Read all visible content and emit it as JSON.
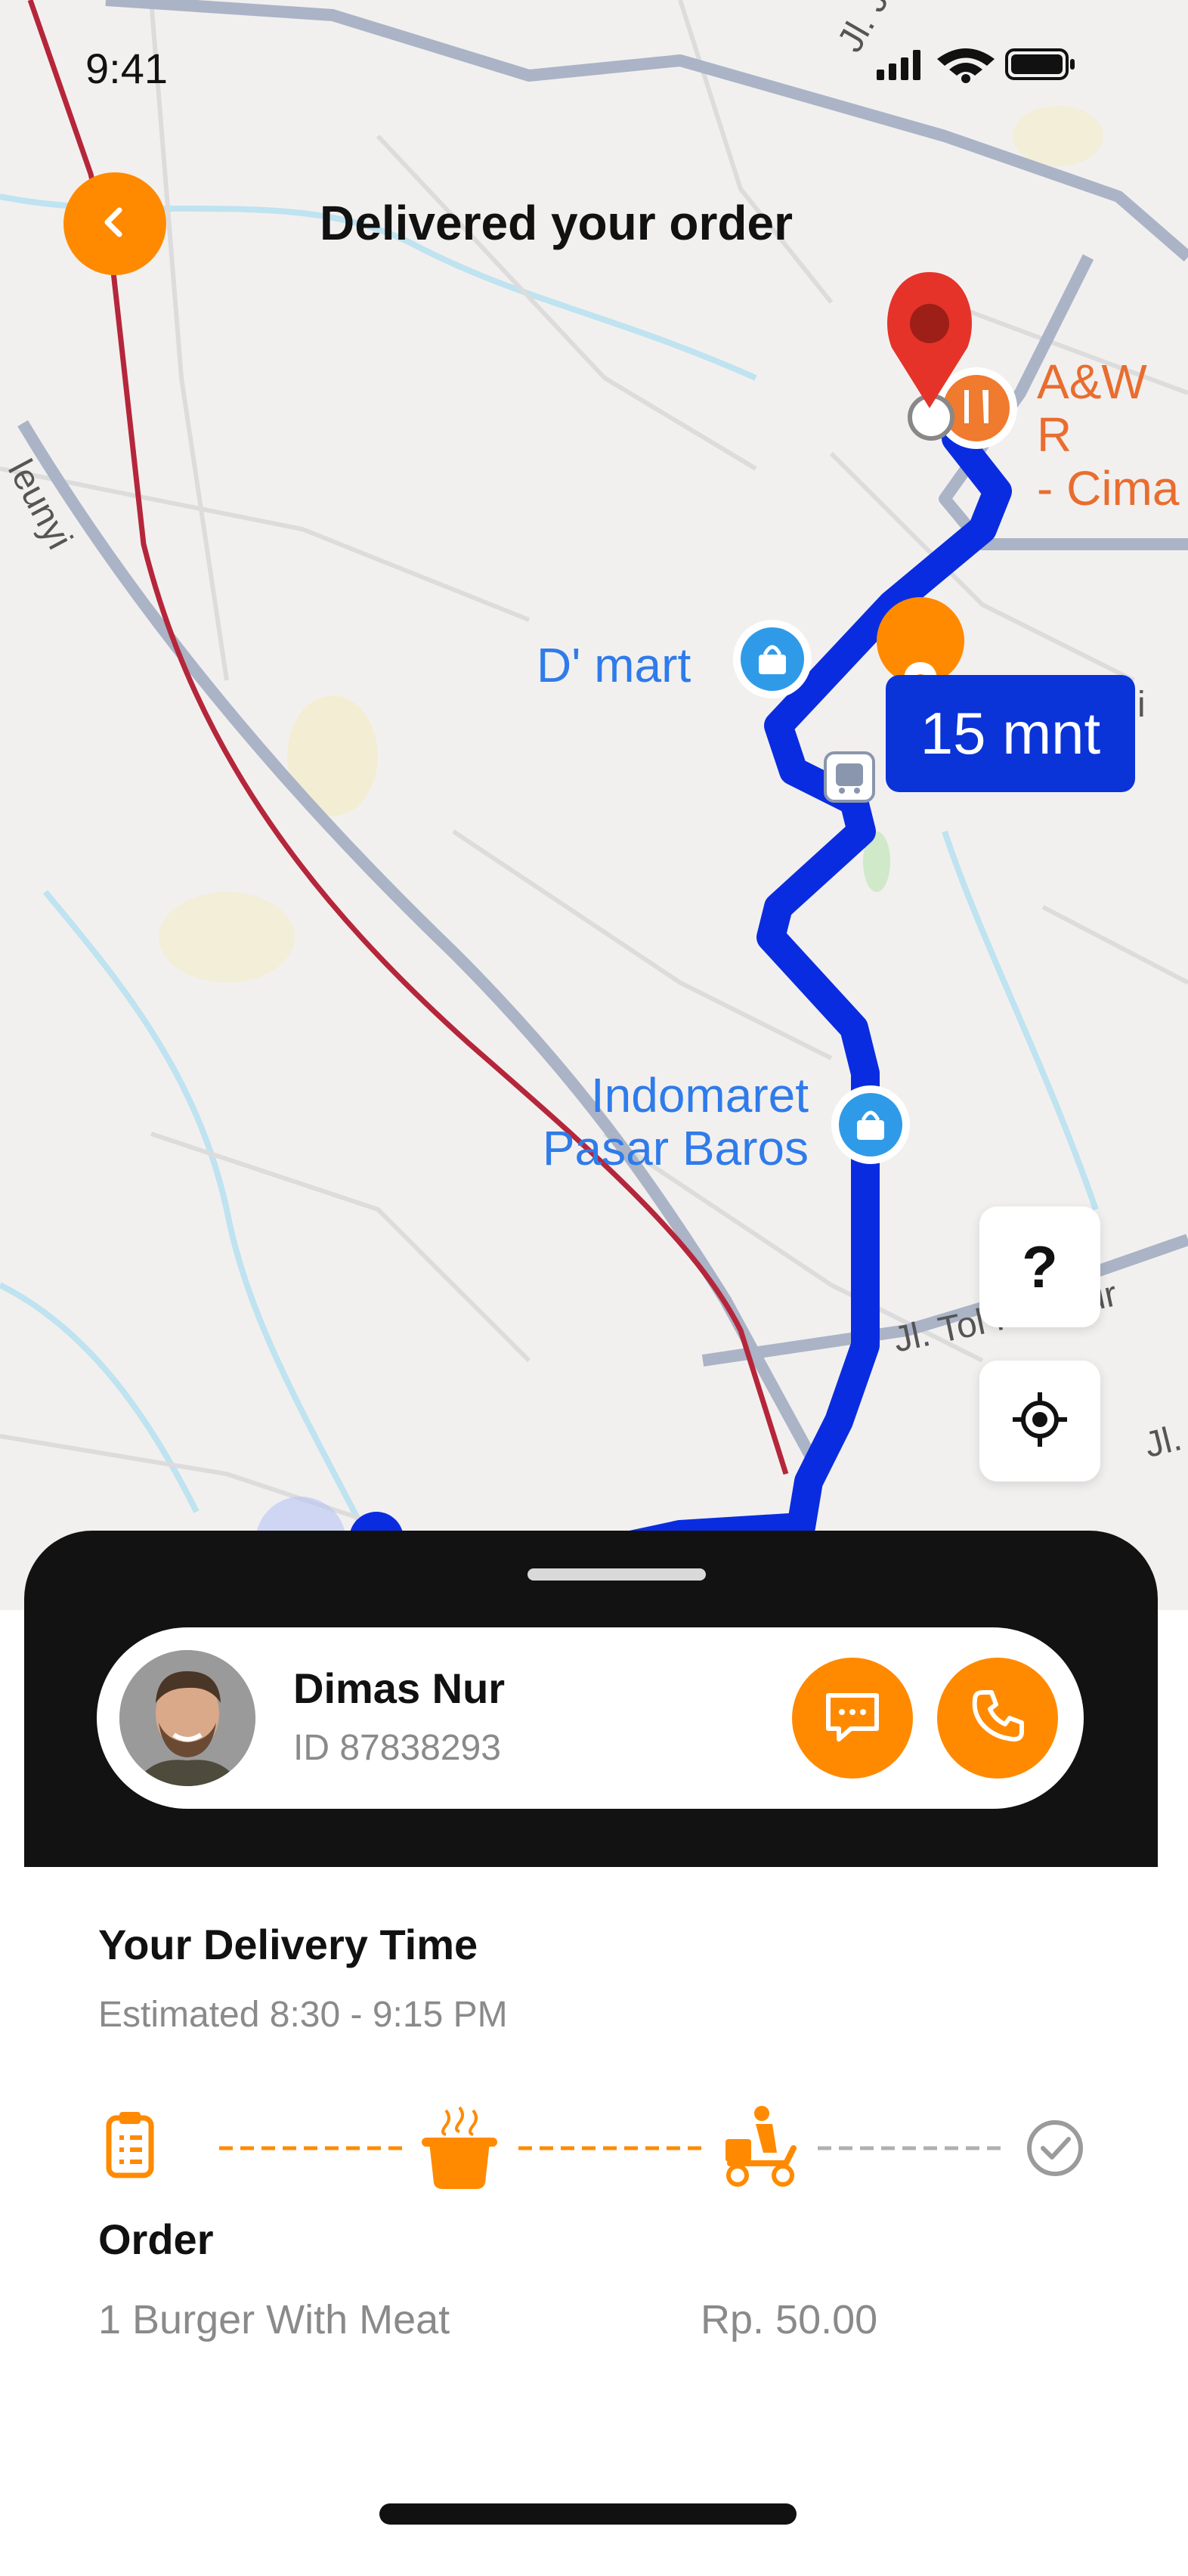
{
  "status_bar": {
    "time": "9:41"
  },
  "header": {
    "title": "Delivered your order"
  },
  "map": {
    "places": {
      "restaurant_line1": "A&W R",
      "restaurant_line2": "- Cima",
      "dmart": "D' mart",
      "indomaret_line1": "Indomaret",
      "indomaret_line2": "Pasar Baros"
    },
    "roads": {
      "top": "Jl. J",
      "left": "leunyi",
      "tol": "Jl. Tol Pasteur",
      "right": "Jl.",
      "near_badge": "i"
    },
    "eta_badge": "15 mnt",
    "help_button": "?"
  },
  "driver": {
    "name": "Dimas Nur",
    "id_text": "ID 87838293"
  },
  "delivery": {
    "title": "Your Delivery Time",
    "estimate": "Estimated 8:30 - 9:15 PM"
  },
  "order": {
    "title": "Order",
    "item": "1 Burger With Meat",
    "price": "Rp. 50.00"
  },
  "colors": {
    "accent": "#FF8A00",
    "route": "#0A33D8",
    "dark_sheet": "#121212",
    "inactive": "#9B9B9B"
  },
  "icons": {
    "back": "chevron-left-icon",
    "chat": "chat-bubble-icon",
    "call": "phone-icon",
    "locate": "crosshair-icon",
    "steps": [
      "clipboard-icon",
      "cooking-pot-icon",
      "delivery-scooter-icon",
      "check-circle-icon"
    ]
  }
}
